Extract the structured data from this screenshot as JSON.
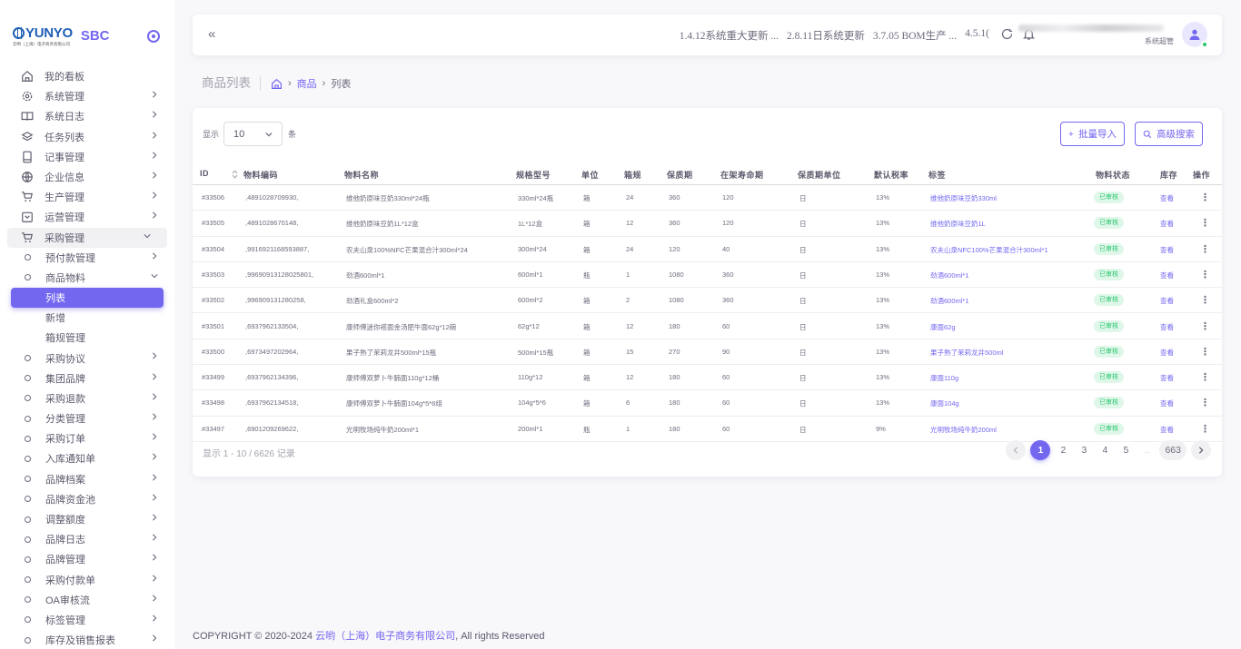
{
  "brand": {
    "logo_text": "YUNYO",
    "logo_sub": "云哟（上海）电子商务有限公司",
    "product": "SBC"
  },
  "sidebar": {
    "items": [
      {
        "label": "我的看板",
        "icon": "home-icon",
        "chev": false
      },
      {
        "label": "系统管理",
        "icon": "settings-icon",
        "chev": true
      },
      {
        "label": "系统日志",
        "icon": "book-icon",
        "chev": true
      },
      {
        "label": "任务列表",
        "icon": "layers-icon",
        "chev": true
      },
      {
        "label": "记事管理",
        "icon": "tablet-icon",
        "chev": true
      },
      {
        "label": "企业信息",
        "icon": "globe-icon",
        "chev": true
      },
      {
        "label": "生产管理",
        "icon": "cart-icon",
        "chev": true
      },
      {
        "label": "运营管理",
        "icon": "calendar-icon",
        "chev": true
      }
    ],
    "open_group": "采购管理",
    "sub_items": [
      "预付款管理",
      "商品物料"
    ],
    "leaf_items": [
      "列表",
      "新增",
      "箱规管理"
    ],
    "rest_items": [
      "采购协议",
      "集团品牌",
      "采购退款",
      "分类管理",
      "采购订单",
      "入库通知单",
      "品牌档案",
      "品牌资金池",
      "调整额度",
      "品牌日志",
      "品牌管理",
      "采购付款单",
      "OA审核流",
      "标签管理",
      "库存及销售报表"
    ]
  },
  "header": {
    "collapse_label": "«",
    "notices": [
      "1.4.12系统重大更新 ...",
      "2.8.11日系统更新",
      "3.7.05 BOM生产 ...",
      "4.5.1("
    ],
    "role": "系统超管"
  },
  "breadcrumb": {
    "title": "商品列表",
    "product": "商品",
    "current": "列表",
    "sep": "›"
  },
  "table_controls": {
    "show_label": "显示",
    "page_size": "10",
    "unit_label": "条",
    "import_label": "批量导入",
    "search_label": "高级搜索"
  },
  "columns": [
    "ID",
    "物料编码",
    "物料名称",
    "规格型号",
    "单位",
    "箱规",
    "保质期",
    "在架寿命期",
    "保质期单位",
    "默认税率",
    "标签",
    "物料状态",
    "库存",
    "操作"
  ],
  "rows": [
    {
      "id": "#33506",
      "code": ",4891028709930,",
      "name": "维他奶原味豆奶330ml*24瓶",
      "spec": "330ml*24瓶",
      "unit": "箱",
      "box": "24",
      "shelf": "360",
      "life": "120",
      "shelf_unit": "日",
      "tax": "13%",
      "tag": "维他奶原味豆奶330ml",
      "status": "已审核",
      "stock": "查看"
    },
    {
      "id": "#33505",
      "code": ",4891028670148,",
      "name": "维他奶原味豆奶1L*12盒",
      "spec": "1L*12盒",
      "unit": "箱",
      "box": "12",
      "shelf": "360",
      "life": "120",
      "shelf_unit": "日",
      "tax": "13%",
      "tag": "维他奶原味豆奶1L",
      "status": "已审核",
      "stock": "查看"
    },
    {
      "id": "#33504",
      "code": ",9916921168593887,",
      "name": "农夫山泉100%NFC芒果混合汁300ml*24",
      "spec": "300ml*24",
      "unit": "箱",
      "box": "24",
      "shelf": "120",
      "life": "40",
      "shelf_unit": "日",
      "tax": "13%",
      "tag": "农夫山泉NFC100%芒果混合汁300ml*1",
      "status": "已审核",
      "stock": "查看"
    },
    {
      "id": "#33503",
      "code": ",99690913128025801,",
      "name": "劲酒600ml*1",
      "spec": "600ml*1",
      "unit": "瓶",
      "box": "1",
      "shelf": "1080",
      "life": "360",
      "shelf_unit": "日",
      "tax": "13%",
      "tag": "劲酒600ml*1",
      "status": "已审核",
      "stock": "查看"
    },
    {
      "id": "#33502",
      "code": ",996909131280258,",
      "name": "劲酒礼盒600ml*2",
      "spec": "600ml*2",
      "unit": "箱",
      "box": "2",
      "shelf": "1080",
      "life": "360",
      "shelf_unit": "日",
      "tax": "13%",
      "tag": "劲酒600ml*1",
      "status": "已审核",
      "stock": "查看"
    },
    {
      "id": "#33501",
      "code": ",6937962133504,",
      "name": "康师傅迷你褡面金汤肥牛面62g*12碗",
      "spec": "62g*12",
      "unit": "箱",
      "box": "12",
      "shelf": "180",
      "life": "60",
      "shelf_unit": "日",
      "tax": "13%",
      "tag": "康面62g",
      "status": "已审核",
      "stock": "查看"
    },
    {
      "id": "#33500",
      "code": ",6973497202964,",
      "name": "果子熟了茉莉龙井500ml*15瓶",
      "spec": "500ml*15瓶",
      "unit": "箱",
      "box": "15",
      "shelf": "270",
      "life": "90",
      "shelf_unit": "日",
      "tax": "13%",
      "tag": "果子熟了茉莉龙井500ml",
      "status": "已审核",
      "stock": "查看"
    },
    {
      "id": "#33499",
      "code": ",6937962134396,",
      "name": "康师傅双萝卜牛腩面110g*12桶",
      "spec": "110g*12",
      "unit": "箱",
      "box": "12",
      "shelf": "180",
      "life": "60",
      "shelf_unit": "日",
      "tax": "13%",
      "tag": "康面110g",
      "status": "已审核",
      "stock": "查看"
    },
    {
      "id": "#33498",
      "code": ",6937962134518,",
      "name": "康师傅双萝卜牛腩面104g*5*6组",
      "spec": "104g*5*6",
      "unit": "箱",
      "box": "6",
      "shelf": "180",
      "life": "60",
      "shelf_unit": "日",
      "tax": "13%",
      "tag": "康面104g",
      "status": "已审核",
      "stock": "查看"
    },
    {
      "id": "#33497",
      "code": ",6901209269622,",
      "name": "光明牧场纯牛奶200ml*1",
      "spec": "200ml*1",
      "unit": "瓶",
      "box": "1",
      "shelf": "180",
      "life": "60",
      "shelf_unit": "日",
      "tax": "9%",
      "tag": "光明牧场纯牛奶200ml",
      "status": "已审核",
      "stock": "查看"
    }
  ],
  "pagination": {
    "info": "显示 1 - 10 / 6626 记录",
    "pages": [
      "1",
      "2",
      "3",
      "4",
      "5",
      "...",
      "663"
    ],
    "current": "1"
  },
  "footer": {
    "prefix": "COPYRIGHT © 2020-2024 ",
    "company": "云哟（上海）电子商务有限公司",
    "suffix": ", All rights Reserved"
  },
  "colors": {
    "accent": "#7367f0",
    "success": "#28c76f",
    "text": "#5d596c",
    "bg": "#f8f7fa"
  }
}
